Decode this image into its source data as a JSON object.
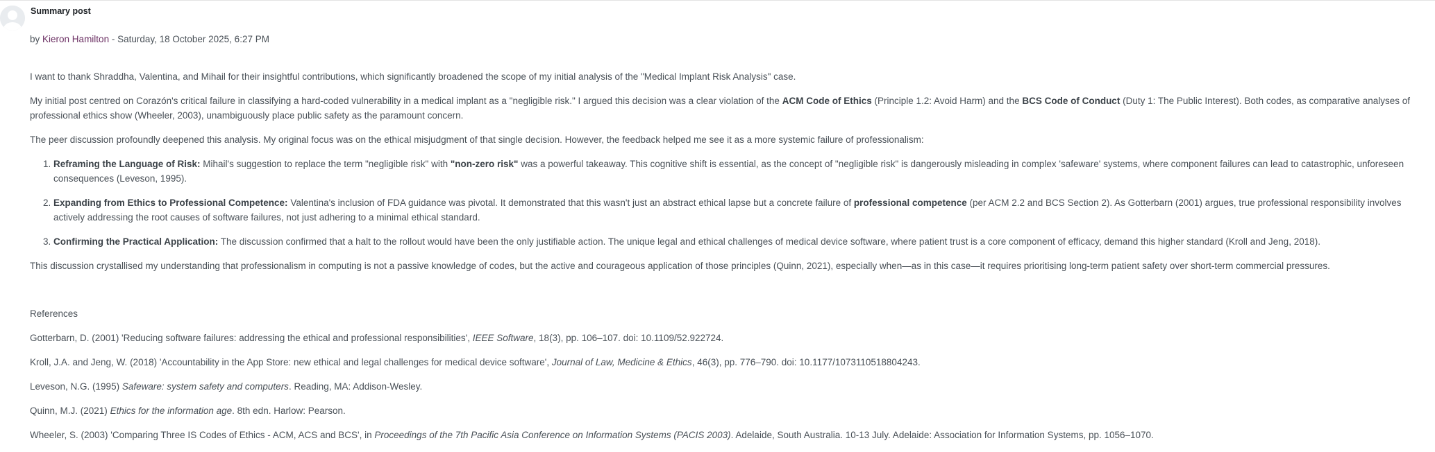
{
  "post": {
    "subject": "Summary post",
    "by_prefix": "by",
    "author": "Kieron Hamilton",
    "separator": " - ",
    "date": "Saturday, 18 October 2025, 6:27 PM"
  },
  "content": {
    "intro": "I want to thank Shraddha, Valentina, and Mihail for their insightful contributions, which significantly broadened the scope of my initial analysis of the \"Medical Implant Risk Analysis\" case.",
    "p2": {
      "a": "My initial post centred on Corazón's critical failure in classifying a hard-coded vulnerability in a medical implant as a \"negligible risk.\" I argued this decision was a clear violation of the ",
      "b": "ACM Code of Ethics",
      "c": " (Principle 1.2: Avoid Harm) and the ",
      "d": "BCS Code of Conduct",
      "e": " (Duty 1: The Public Interest). Both codes, as comparative analyses of professional ethics show (Wheeler, 2003), unambiguously place public safety as the paramount concern."
    },
    "p3": "The peer discussion profoundly deepened this analysis. My original focus was on the ethical misjudgment of that single decision. However, the feedback helped me see it as a more systemic failure of professionalism:",
    "items": [
      {
        "title": "Reframing the Language of Risk:",
        "a": " Mihail's suggestion to replace the term \"negligible risk\" with ",
        "b": "\"non-zero risk\"",
        "c": " was a powerful takeaway. This cognitive shift is essential, as the concept of \"negligible risk\" is dangerously misleading in complex 'safeware' systems, where component failures can lead to catastrophic, unforeseen consequences (Leveson, 1995)."
      },
      {
        "title": "Expanding from Ethics to Professional Competence:",
        "a": " Valentina's inclusion of FDA guidance was pivotal. It demonstrated that this wasn't just an abstract ethical lapse but a concrete failure of ",
        "b": "professional competence",
        "c": " (per ACM 2.2 and BCS Section 2). As Gotterbarn (2001) argues, true professional responsibility involves actively addressing the root causes of software failures, not just adhering to a minimal ethical standard."
      },
      {
        "title": "Confirming the Practical Application:",
        "a": " The discussion confirmed that a halt to the rollout would have been the only justifiable action. The unique legal and ethical challenges of medical device software, where patient trust is a core component of efficacy, demand this higher standard (Kroll and Jeng, 2018).",
        "b": "",
        "c": ""
      }
    ],
    "p4": "This discussion crystallised my understanding that professionalism in computing is not a passive knowledge of codes, but the active and courageous application of those principles (Quinn, 2021), especially when—as in this case—it requires prioritising long-term patient safety over short-term commercial pressures.",
    "references_heading": "References",
    "references": [
      {
        "a": "Gotterbarn, D. (2001) 'Reducing software failures: addressing the ethical and professional responsibilities', ",
        "i": "IEEE Software",
        "b": ", 18(3), pp. 106–107. doi: 10.1109/52.922724."
      },
      {
        "a": "Kroll, J.A. and Jeng, W. (2018) 'Accountability in the App Store: new ethical and legal challenges for medical device software', ",
        "i": "Journal of Law, Medicine & Ethics",
        "b": ", 46(3), pp. 776–790. doi: 10.1177/1073110518804243."
      },
      {
        "a": "Leveson, N.G. (1995) ",
        "i": "Safeware: system safety and computers",
        "b": ". Reading, MA: Addison-Wesley."
      },
      {
        "a": "Quinn, M.J. (2021) ",
        "i": "Ethics for the information age",
        "b": ". 8th edn. Harlow: Pearson."
      },
      {
        "a": "Wheeler, S. (2003) 'Comparing Three IS Codes of Ethics - ACM, ACS and BCS', in ",
        "i": "Proceedings of the 7th Pacific Asia Conference on Information Systems (PACIS 2003)",
        "b": ". Adelaide, South Australia. 10-13 July. Adelaide: Association for Information Systems, pp. 1056–1070."
      }
    ]
  },
  "colors": {
    "text": "#495057",
    "author_link": "#6b2f63",
    "avatar_bg": "#e9ecef"
  }
}
